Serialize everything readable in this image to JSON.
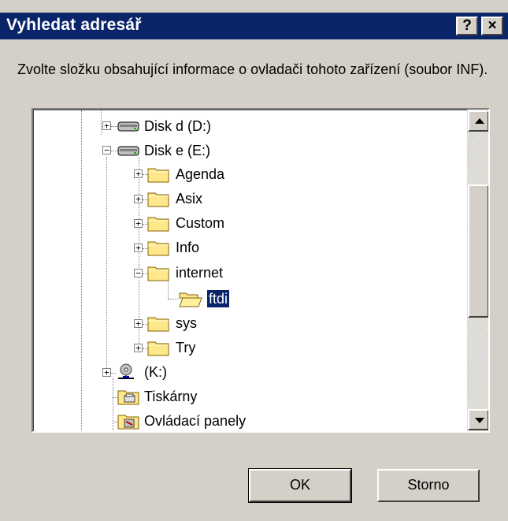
{
  "window": {
    "title": "Vyhledat adresář",
    "help_label": "?",
    "close_label": "×"
  },
  "instructions": "Zvolte složku obsahující informace o ovladači tohoto zařízení (soubor INF).",
  "tree": {
    "items": [
      {
        "label": "Disk d (D:)",
        "icon": "drive-icon",
        "expander": "+"
      },
      {
        "label": "Disk e (E:)",
        "icon": "drive-icon",
        "expander": "−"
      },
      {
        "label": "Agenda",
        "icon": "folder-icon",
        "expander": "+"
      },
      {
        "label": "Asix",
        "icon": "folder-icon",
        "expander": "+"
      },
      {
        "label": "Custom",
        "icon": "folder-icon",
        "expander": "+"
      },
      {
        "label": "Info",
        "icon": "folder-icon",
        "expander": "+"
      },
      {
        "label": "internet",
        "icon": "folder-icon",
        "expander": "−"
      },
      {
        "label": "ftdi",
        "icon": "open-folder-icon",
        "selected": true
      },
      {
        "label": "sys",
        "icon": "folder-icon",
        "expander": "+"
      },
      {
        "label": "Try",
        "icon": "folder-icon",
        "expander": "+"
      },
      {
        "label": "(K:)",
        "icon": "network-drive-icon",
        "expander": "+"
      },
      {
        "label": "Tiskárny",
        "icon": "printer-folder-icon"
      },
      {
        "label": "Ovládací panely",
        "icon": "control-panel-icon"
      }
    ]
  },
  "buttons": {
    "ok": "OK",
    "cancel": "Storno"
  },
  "colors": {
    "title_bar": "#0a246a",
    "face": "#d4d0c8",
    "folder": "#ffe88c",
    "selection": "#0a246a"
  }
}
